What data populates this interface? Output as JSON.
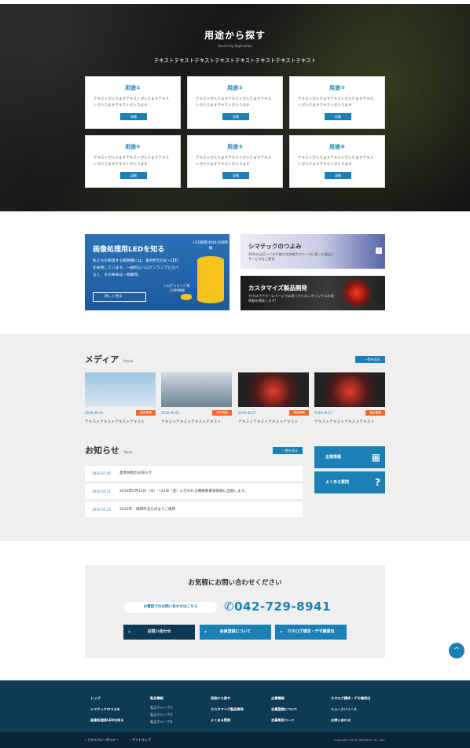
{
  "hero": {
    "title": "用途から探す",
    "subtitle": "Search by Application",
    "lead": "テキストテキストテキストテキストテキストテキストテキストテキスト",
    "cards": [
      {
        "title": "用途①",
        "desc": "テキストが入りますテキストが入りますテキストが入りますテキストが入ります",
        "button": "詳細"
      },
      {
        "title": "用途②",
        "desc": "テキストが入りますテキストが入りますテキストが入りますテキストが入ります",
        "button": "詳細"
      },
      {
        "title": "用途③",
        "desc": "テキストが入りますテキストが入りますテキストが入りますテキストが入ります",
        "button": "詳細"
      },
      {
        "title": "用途④",
        "desc": "テキストが入りますテキストが入りますテキストが入りますテキストが入ります",
        "button": "詳細"
      },
      {
        "title": "用途⑤",
        "desc": "テキストが入りますテキストが入りますテキストが入りますテキストが入ります",
        "button": "詳細"
      },
      {
        "title": "用途⑥",
        "desc": "テキストが入りますテキストが入りますテキストが入りますテキストが入ります",
        "button": "詳細"
      }
    ]
  },
  "banner_led": {
    "title": "画像処理用LEDを知る",
    "desc": "私たちの製造する照明機には、第4世代の光・LEDを採用しています。一般的なハロゲンランプと比べると、その寿命は一目瞭然。",
    "button": "詳しく見る",
    "led_label": "LED照明 約30,000時間",
    "halogen_label": "ハロゲンランプ 約3,000時間"
  },
  "banner_strength": {
    "title": "シマテックのつよみ",
    "desc": "20年以上培ってきた確かな技術力でニーズに合った製品とサービスをご提供"
  },
  "banner_custom": {
    "title": "カスタマイズ製品開発",
    "desc": "カタログやホームページでは見つからないオリジナルの照明器を開発します！"
  },
  "media": {
    "heading": "メディア",
    "heading_en": "Media",
    "more": "一覧を見る",
    "items": [
      {
        "date": "2016.09.20",
        "tag": "製品情報",
        "title": "テキストテキストテキストテキスト"
      },
      {
        "date": "2016.09.05",
        "tag": "製品情報",
        "title": "テキストテキストテキストテキスト"
      },
      {
        "date": "2016.06.27",
        "tag": "製品情報",
        "title": "テキストテキストテキストテキスト"
      },
      {
        "date": "2016.06.27",
        "tag": "製品情報",
        "title": "テキストテキストテキストテキスト"
      }
    ]
  },
  "news": {
    "heading": "お知らせ",
    "heading_en": "News",
    "more": "一覧を見る",
    "items": [
      {
        "date": "2016.07.05",
        "title": "夏季休暇のお知らせ"
      },
      {
        "date": "2016.04.11",
        "title": "2016年6月22日（水）～24日（金）に行われる機械要素技術展に出展します。"
      },
      {
        "date": "2016.05.14",
        "title": "2016年　福岡県北九州よりご挨拶"
      }
    ]
  },
  "side": {
    "company": "企業情報",
    "faq": "よくある質問"
  },
  "contact": {
    "title": "お気軽にお問い合わせください",
    "tel_label": "お電話でのお問い合わせはこちら",
    "tel": "042-729-8941",
    "buttons": [
      "お問い合わせ",
      "会員登録について",
      "カタログ請求・デモ機貸出"
    ]
  },
  "footer": {
    "col1": [
      "トップ",
      "シマテックのつよみ",
      "画像処理用LEDを知る"
    ],
    "col2_title": "製品情報",
    "col2_sub": [
      "製品グループ①",
      "製品グループ②",
      "製品グループ③"
    ],
    "col3": [
      "用途から探す",
      "カスタマイズ製品開発",
      "よくある質問"
    ],
    "col4": [
      "企業情報",
      "会員登録について",
      "会員専用ページ"
    ],
    "col5": [
      "カタログ請求・デモ機貸出",
      "ニュースリリース",
      "お問い合わせ"
    ],
    "privacy": "プライバシーポリシー",
    "sitemap": "サイトマップ",
    "copyright": "Copyright 2016 Shimatec Co., Ltd."
  },
  "colors": {
    "accent": "#1a80b6",
    "footer": "#0f3a55",
    "tag": "#ef6c24"
  }
}
